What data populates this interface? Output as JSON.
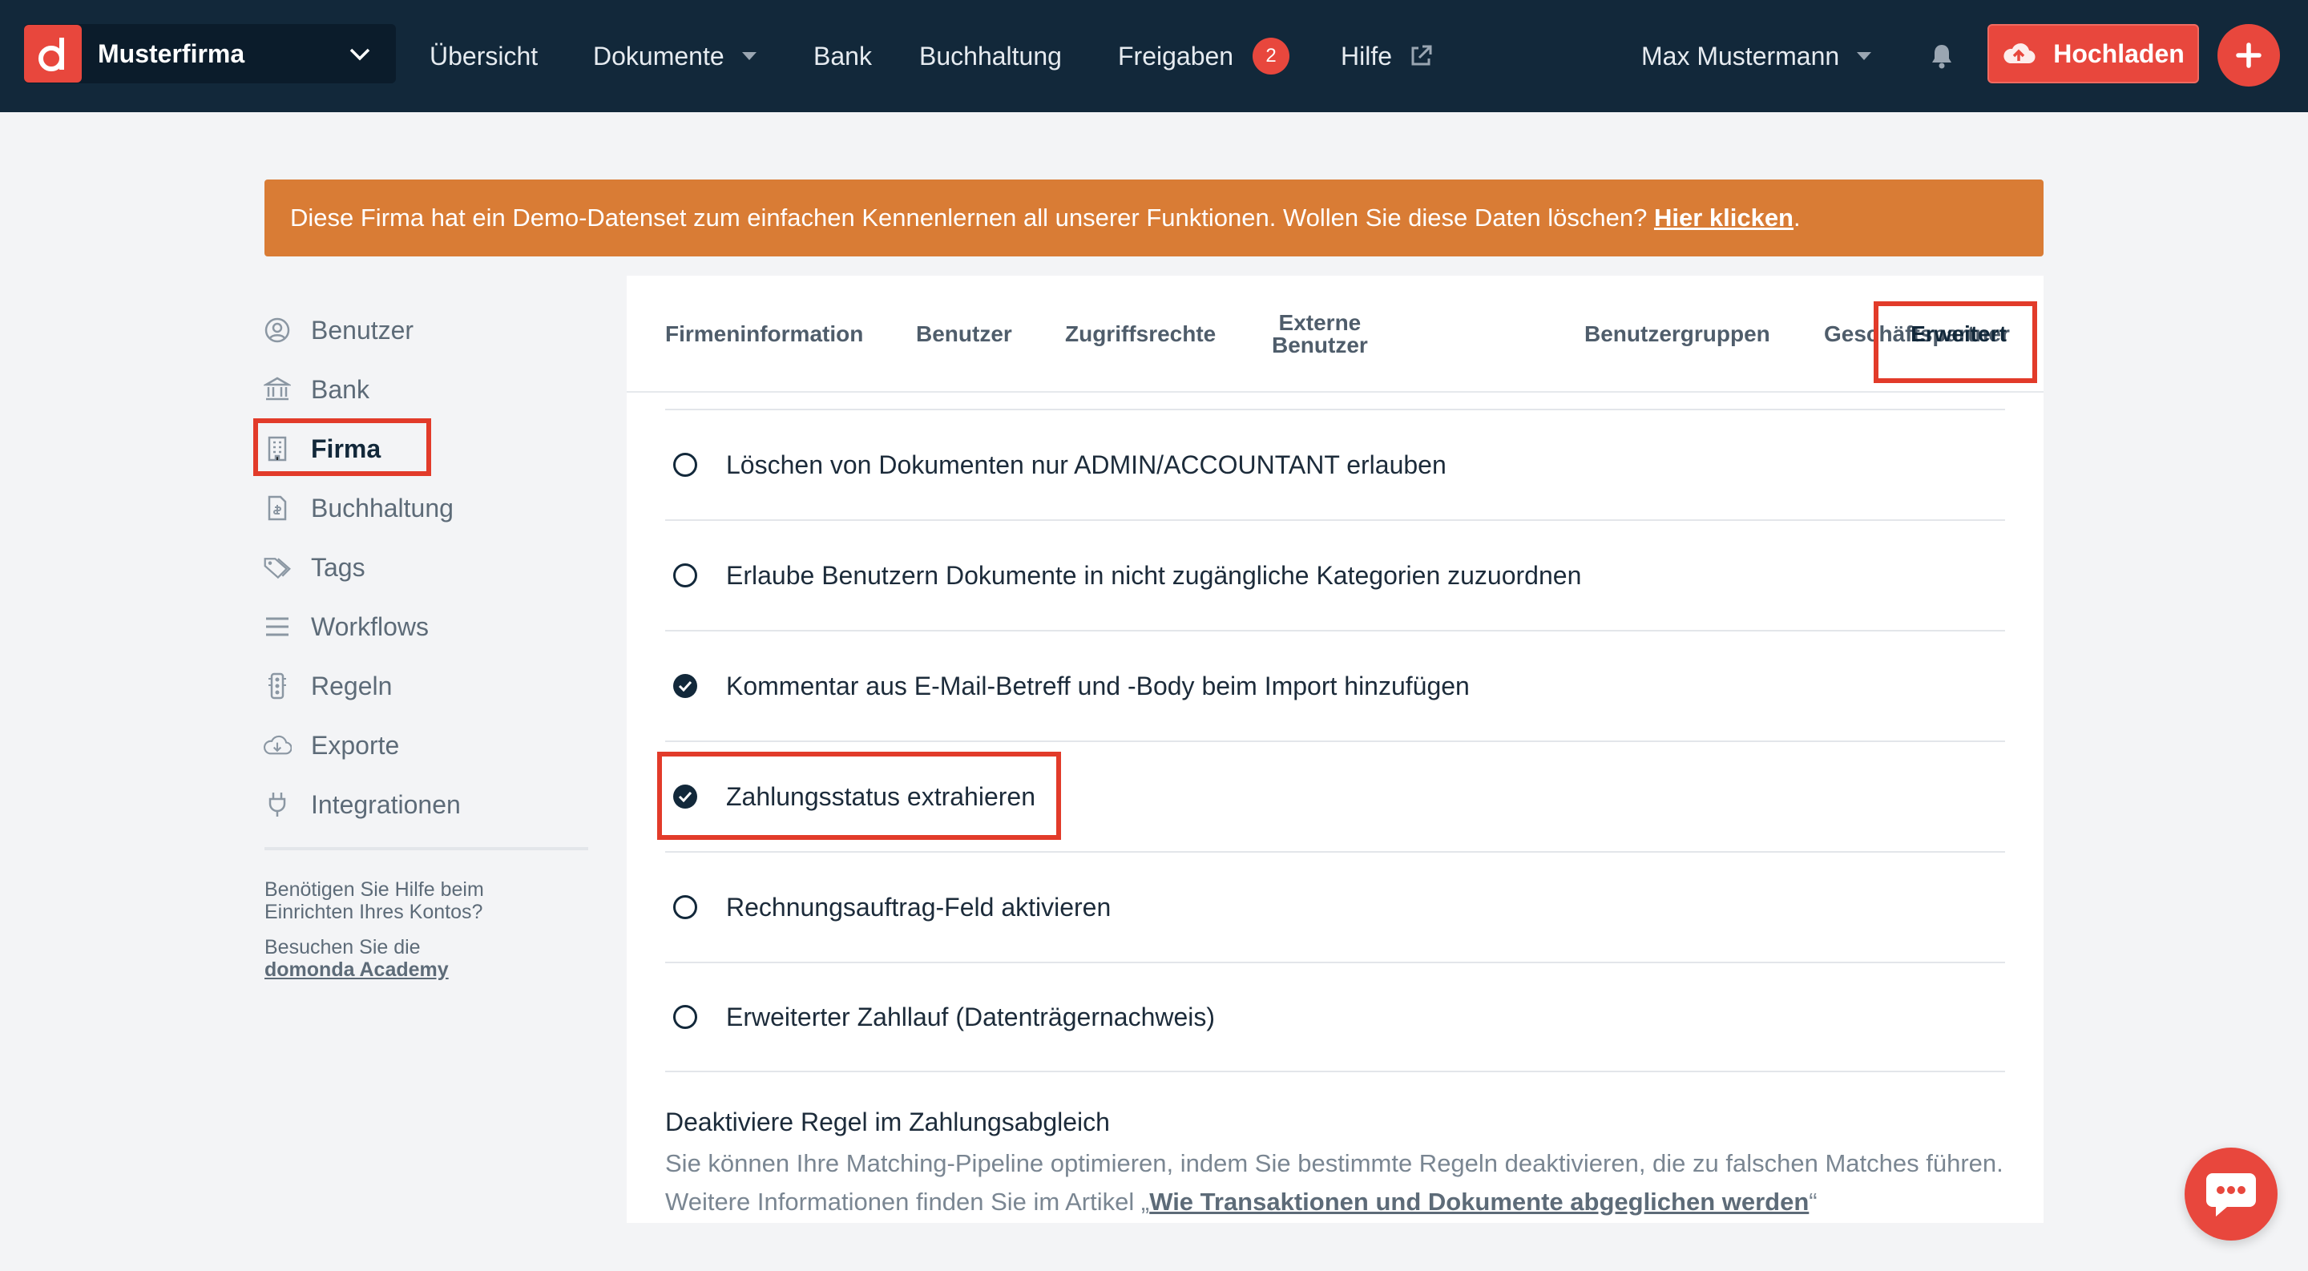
{
  "topbar": {
    "company": "Musterfirma",
    "nav": {
      "overview": "Übersicht",
      "documents": "Dokumente",
      "bank": "Bank",
      "accounting": "Buchhaltung",
      "approvals": "Freigaben",
      "approvals_count": "2",
      "help": "Hilfe"
    },
    "user": "Max Mustermann",
    "upload": "Hochladen"
  },
  "banner": {
    "text": "Diese Firma hat ein Demo-Datenset zum einfachen Kennenlernen all unserer Funktionen. Wollen Sie diese Daten löschen?",
    "link": "Hier klicken",
    "end": "."
  },
  "sidebar": {
    "items": [
      {
        "label": "Benutzer",
        "icon": "user-circle-icon"
      },
      {
        "label": "Bank",
        "icon": "bank-icon"
      },
      {
        "label": "Firma",
        "icon": "building-icon"
      },
      {
        "label": "Buchhaltung",
        "icon": "invoice-icon"
      },
      {
        "label": "Tags",
        "icon": "tag-icon"
      },
      {
        "label": "Workflows",
        "icon": "list-icon"
      },
      {
        "label": "Regeln",
        "icon": "traffic-light-icon"
      },
      {
        "label": "Exporte",
        "icon": "cloud-download-icon"
      },
      {
        "label": "Integrationen",
        "icon": "plug-icon"
      }
    ],
    "active": "Firma",
    "help_question": "Benötigen Sie Hilfe beim Einrichten Ihres Kontos?",
    "help_visit": "Besuchen Sie die",
    "help_link": "domonda Academy"
  },
  "tabs": {
    "company_info": "Firmeninformation",
    "users": "Benutzer",
    "access_rights": "Zugriffsrechte",
    "external_users_1": "Externe",
    "external_users_2": "Benutzer",
    "user_groups": "Benutzergruppen",
    "partners": "Geschäftspartner",
    "advanced": "Erweitert",
    "active": "Erweitert"
  },
  "settings": [
    {
      "label": "Löschen von Dokumenten nur ADMIN/ACCOUNTANT erlauben",
      "checked": false
    },
    {
      "label": "Erlaube Benutzern Dokumente in nicht zugängliche Kategorien zuzuordnen",
      "checked": false
    },
    {
      "label": "Kommentar aus E-Mail-Betreff und -Body beim Import hinzufügen",
      "checked": true
    },
    {
      "label": "Zahlungsstatus extrahieren",
      "checked": true
    },
    {
      "label": "Rechnungsauftrag-Feld aktivieren",
      "checked": false
    },
    {
      "label": "Erweiterter Zahllauf (Datenträgernachweis)",
      "checked": false
    }
  ],
  "section": {
    "title": "Deaktiviere Regel im Zahlungsabgleich",
    "desc": "Sie können Ihre Matching-Pipeline optimieren, indem Sie bestimmte Regeln deaktivieren, die zu falschen Matches führen. Weitere Informationen finden Sie im Artikel „",
    "link": "Wie Transaktionen und Dokumente abgeglichen werden",
    "end": "“"
  },
  "colors": {
    "topbar": "#12283a",
    "accent": "#e8473d",
    "banner": "#d97c35",
    "highlight": "#e23b2a"
  }
}
